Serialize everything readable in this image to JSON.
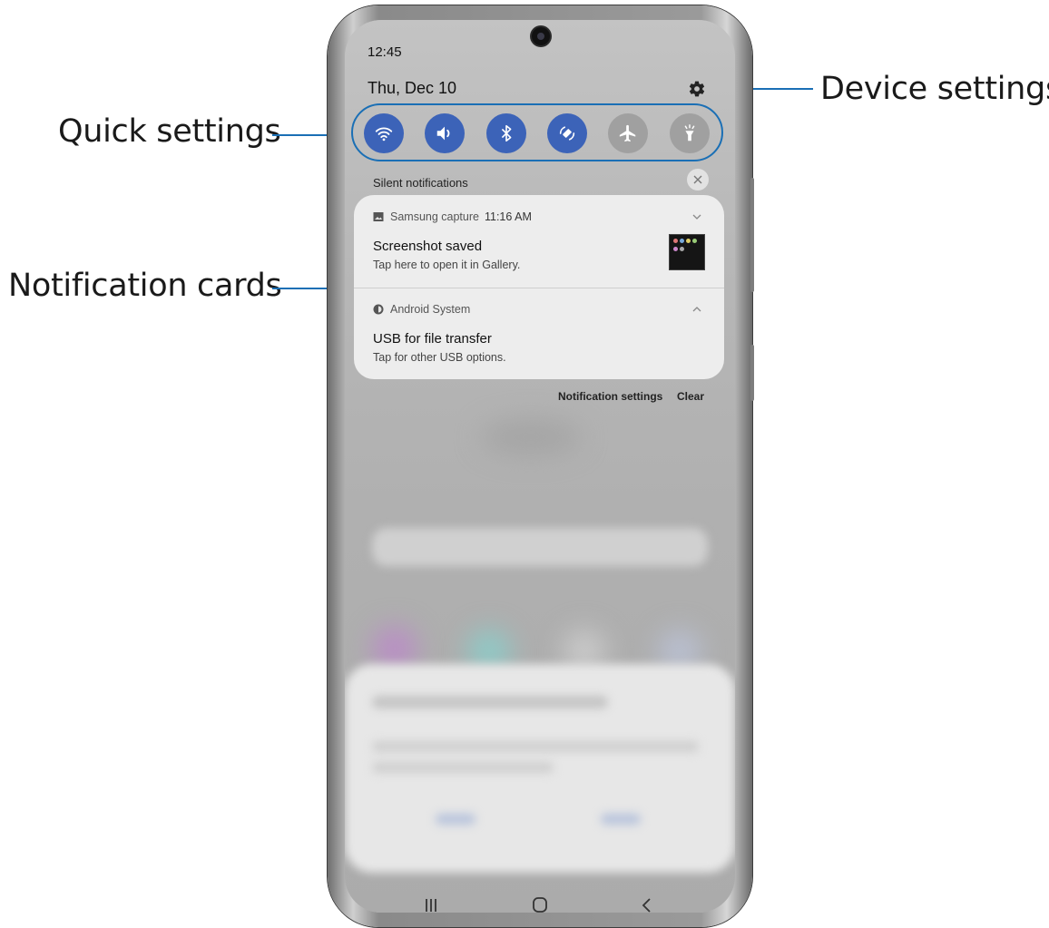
{
  "callouts": {
    "device_settings": "Device settings",
    "quick_settings": "Quick settings",
    "notification_cards": "Notification cards"
  },
  "status": {
    "time": "12:45",
    "date": "Thu, Dec 10"
  },
  "quick_settings": [
    {
      "icon": "wifi-icon",
      "state": "on"
    },
    {
      "icon": "sound-icon",
      "state": "on"
    },
    {
      "icon": "bluetooth-icon",
      "state": "on"
    },
    {
      "icon": "auto-rotate-icon",
      "state": "on"
    },
    {
      "icon": "airplane-mode-icon",
      "state": "off"
    },
    {
      "icon": "flashlight-icon",
      "state": "off"
    }
  ],
  "notifications": {
    "section_title": "Silent notifications",
    "items": [
      {
        "app": "Samsung capture",
        "time": "11:16 AM",
        "title": "Screenshot saved",
        "text": "Tap here to open it in Gallery."
      },
      {
        "app": "Android System",
        "time": "",
        "title": "USB for file transfer",
        "text": "Tap for other USB options."
      }
    ],
    "settings_label": "Notification settings",
    "clear_label": "Clear"
  },
  "colors": {
    "accent": "#1a6fb5",
    "qs_on": "#3c63b8",
    "qs_off": "#a0a0a0"
  }
}
